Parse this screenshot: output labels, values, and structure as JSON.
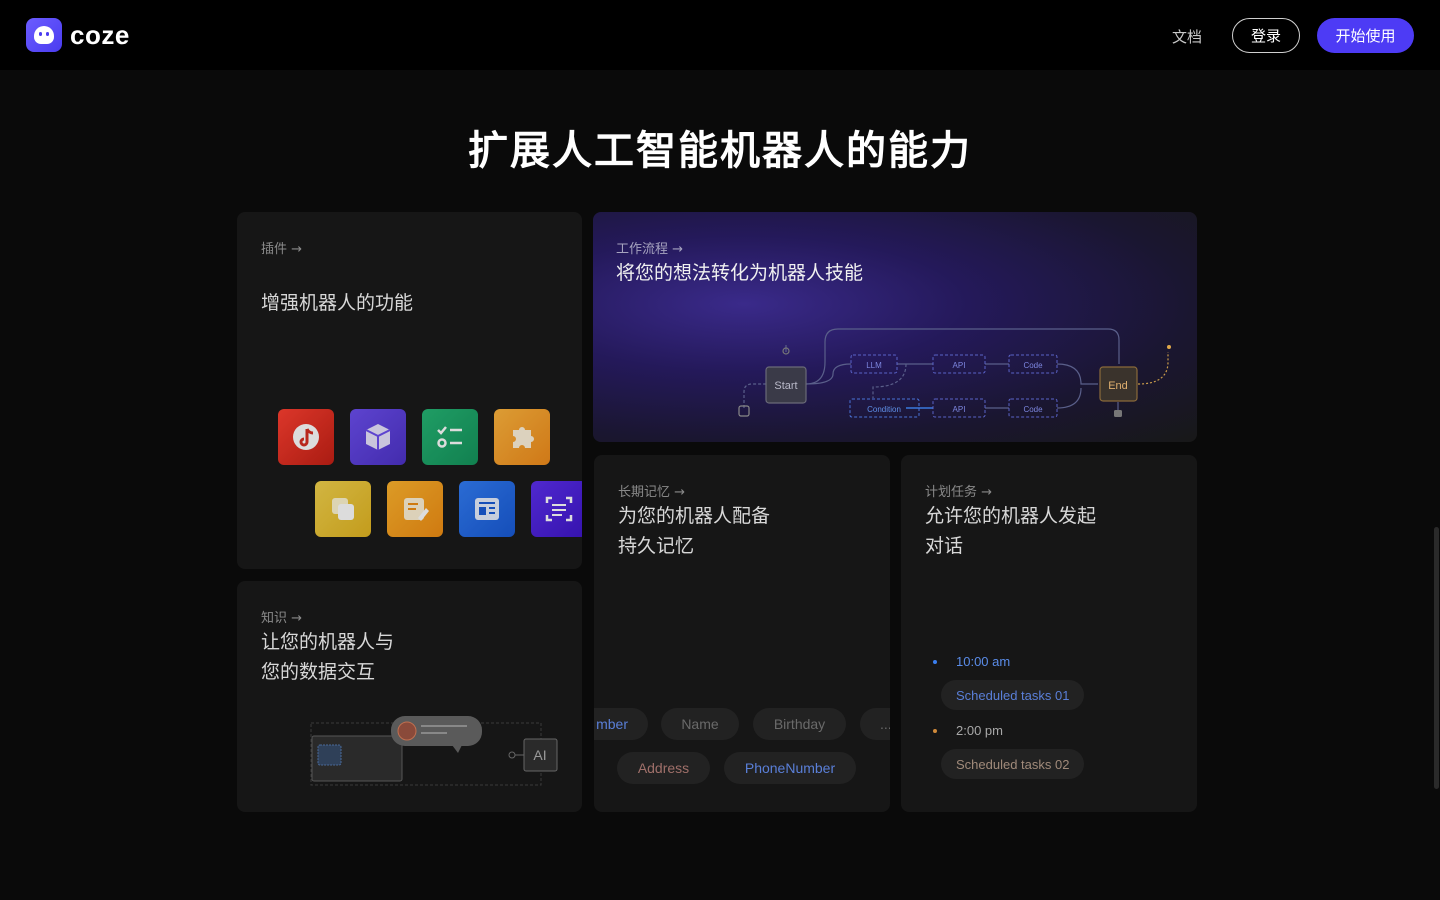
{
  "header": {
    "brand": "coze",
    "nav_docs": "文档",
    "login": "登录",
    "start": "开始使用"
  },
  "colors": {
    "accent": "#4d3bf5",
    "background": "#0a0a0a",
    "card": "#161616"
  },
  "title": "扩展人工智能机器人的能力",
  "cards": {
    "plugins": {
      "tag": "插件 →",
      "title": "增强机器人的功能",
      "icons": [
        "tiktok-icon",
        "cube-icon",
        "checklist-icon",
        "puzzle-icon",
        "layers-icon",
        "notes-icon",
        "news-icon",
        "scan-text-icon"
      ]
    },
    "workflow": {
      "tag": "工作流程 →",
      "title": "将您的想法转化为机器人技能",
      "nodes": {
        "start": "Start",
        "llm": "LLM",
        "api1": "API",
        "code1": "Code",
        "condition": "Condition",
        "api2": "API",
        "code2": "Code",
        "end": "End"
      }
    },
    "knowledge": {
      "tag": "知识 →",
      "title_line1": "让您的机器人与",
      "title_line2": "您的数据交互",
      "ai_label": "AI"
    },
    "memory": {
      "tag": "长期记忆 →",
      "title_line1": "为您的机器人配备",
      "title_line2": "持久记忆",
      "chips_row1": [
        "mber",
        "Name",
        "Birthday",
        "..."
      ],
      "chips_row2": [
        "Address",
        "PhoneNumber"
      ]
    },
    "schedule": {
      "tag": "计划任务 →",
      "title_line1": "允许您的机器人发起",
      "title_line2": "对话",
      "tasks": [
        {
          "time": "10:00 am",
          "label": "Scheduled tasks 01"
        },
        {
          "time": "2:00 pm",
          "label": "Scheduled tasks 02"
        }
      ]
    }
  }
}
